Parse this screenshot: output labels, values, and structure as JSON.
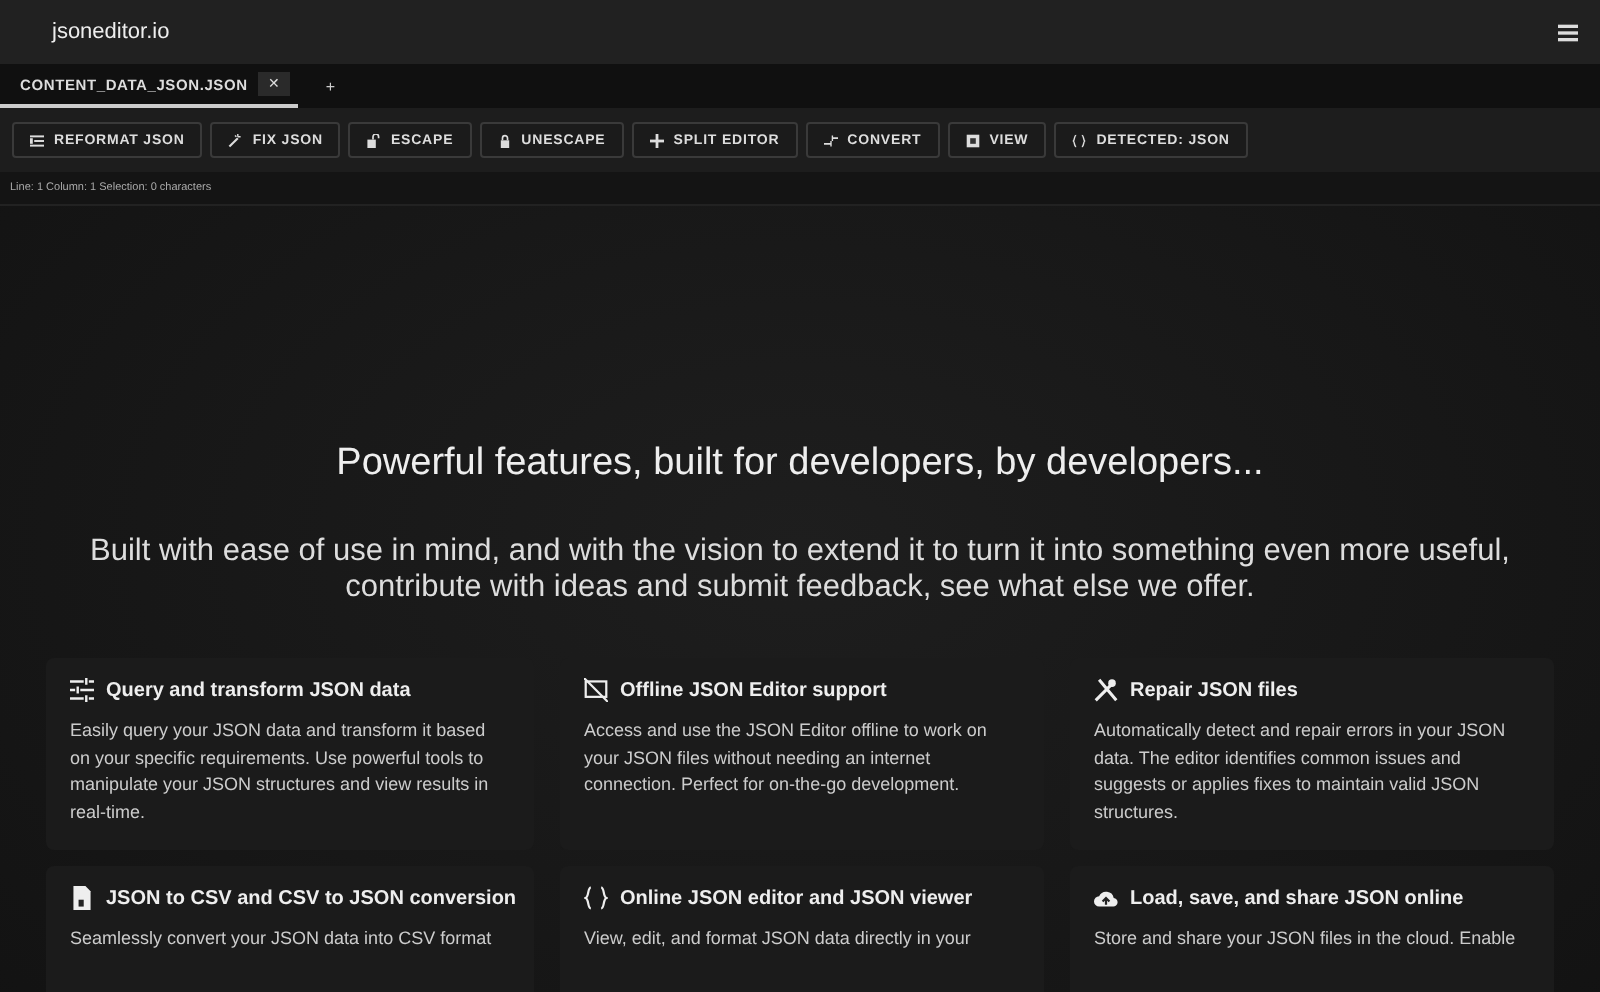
{
  "header": {
    "logo": "jsoneditor.io"
  },
  "tabs": [
    {
      "label": "CONTENT_DATA_JSON.JSON",
      "selected": true,
      "close": "✕"
    }
  ],
  "new_tab": "+",
  "toolbar": [
    {
      "label": "REFORMAT JSON"
    },
    {
      "label": "FIX JSON"
    },
    {
      "label": "ESCAPE"
    },
    {
      "label": "UNESCAPE"
    },
    {
      "label": "SPLIT EDITOR"
    },
    {
      "label": "CONVERT"
    },
    {
      "label": "VIEW"
    },
    {
      "label": "DETECTED: JSON"
    }
  ],
  "status_bar": "Line: 1 Column: 1 Selection: 0 characters",
  "hero": {
    "title": "Powerful features, built for developers, by developers...",
    "subtitle": "Built with ease of use in mind, and with the vision to extend it to turn it into something even more useful, contribute with ideas and submit feedback, see what else we offer."
  },
  "features": [
    {
      "title": "Query and transform JSON data",
      "text": "Easily query your JSON data and transform it based on your specific requirements. Use powerful tools to manipulate your JSON structures and view results in real-time."
    },
    {
      "title": "Offline JSON Editor support",
      "text": "Access and use the JSON Editor offline to work on your JSON files without needing an internet connection. Perfect for on-the-go development."
    },
    {
      "title": "Repair JSON files",
      "text": "Automatically detect and repair errors in your JSON data. The editor identifies common issues and suggests or applies fixes to maintain valid JSON structures."
    },
    {
      "title": "JSON to CSV and CSV to JSON conversion",
      "text": "Seamlessly convert your JSON data into CSV format"
    },
    {
      "title": "Online JSON editor and JSON viewer",
      "text": "View, edit, and format JSON data directly in your"
    },
    {
      "title": "Load, save, and share JSON online",
      "text": "Store and share your JSON files in the cloud. Enable"
    }
  ]
}
